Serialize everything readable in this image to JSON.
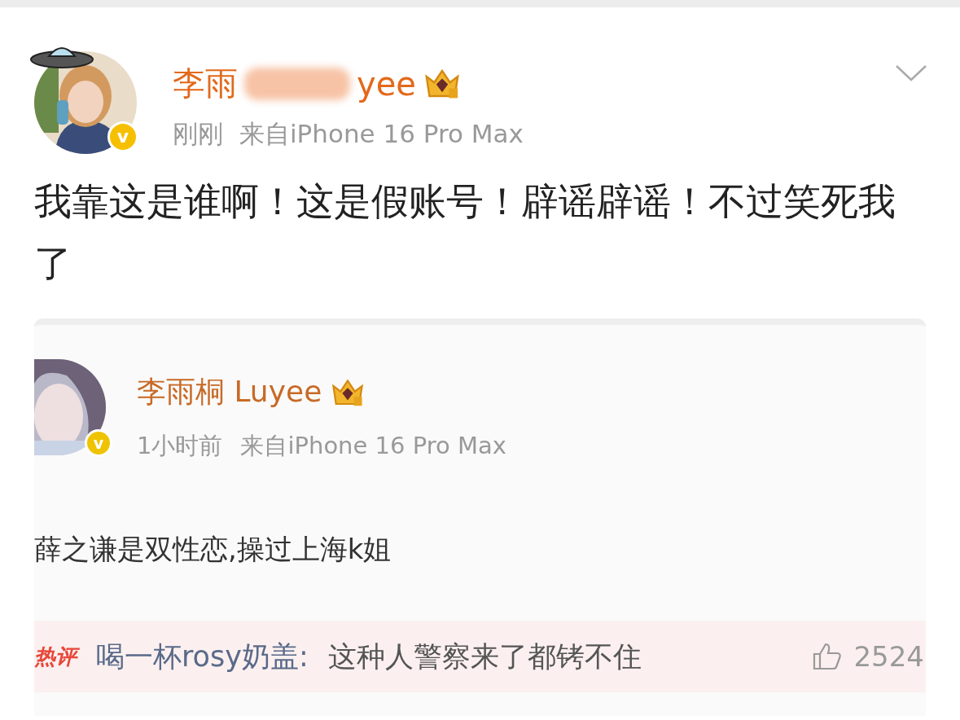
{
  "post": {
    "author_start": "李雨",
    "author_end": "yee",
    "author_blurred": true,
    "verified_mark": "v",
    "time": "刚刚",
    "source": "来自iPhone 16 Pro Max",
    "text": "我靠这是谁啊！这是假账号！辟谣辟谣！不过笑死我了"
  },
  "quoted_screenshot": {
    "author": "李雨桐 Luyee",
    "verified_mark": "v",
    "time": "1小时前",
    "source": "来自iPhone 16 Pro Max",
    "text": "薛之谦是双性恋,操过上海k姐",
    "hot_comment": {
      "label": "热评",
      "user": "喝一杯rosy奶盖:",
      "text": "这种人警察来了都铐不住",
      "likes": "2524"
    }
  }
}
